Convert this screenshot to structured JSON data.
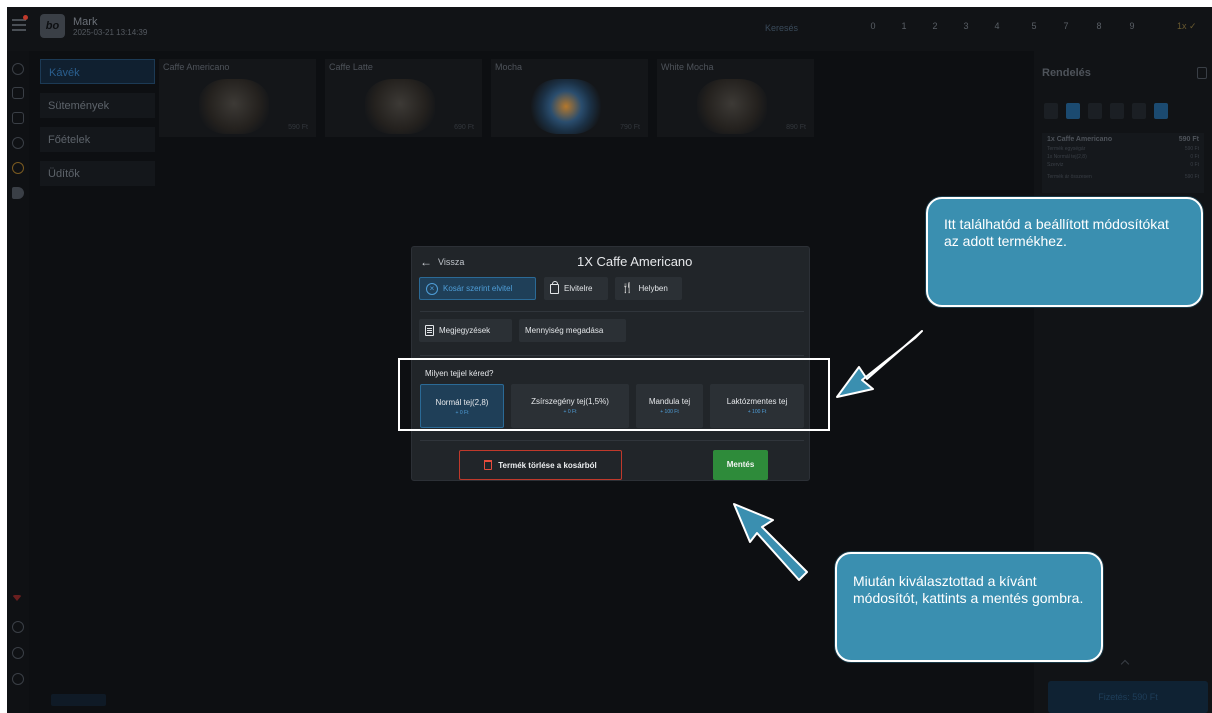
{
  "app": {
    "user_name": "Mark",
    "datetime": "2025-03-21 13:14:39",
    "search_placeholder": "Keresés",
    "numpad": [
      "0",
      "1",
      "2",
      "3",
      "4",
      "5",
      "7",
      "8",
      "9"
    ],
    "lang": "1x ✓"
  },
  "categories": [
    {
      "label": "Kávék",
      "active": true
    },
    {
      "label": "Sütemények",
      "active": false
    },
    {
      "label": "Főételek",
      "active": false
    },
    {
      "label": "Üdítők",
      "active": false
    }
  ],
  "products": [
    {
      "name": "Caffe Americano",
      "price": "590 Ft"
    },
    {
      "name": "Caffe Latte",
      "price": "690 Ft"
    },
    {
      "name": "Mocha",
      "price": "790 Ft"
    },
    {
      "name": "White Mocha",
      "price": "890 Ft"
    }
  ],
  "order": {
    "title": "Rendelés",
    "item_title": "1x Caffe Americano",
    "item_price": "590 Ft",
    "lines": [
      {
        "label": "Termék egységár",
        "value": "590 Ft"
      },
      {
        "label": "1x Normál tej(2,8)",
        "value": "0 Ft"
      },
      {
        "label": "Szerviz",
        "value": "0 Ft"
      },
      {
        "label": "Termék ár összesen",
        "value": "590 Ft"
      }
    ],
    "pay_label": "Fizetés: 590 Ft"
  },
  "modal": {
    "back_label": "Vissza",
    "title": "1X Caffe Americano",
    "takeaway_cart": "Kosár szerint elvitel",
    "takeaway": "Elvitelre",
    "dine_in": "Helyben",
    "notes": "Megjegyzések",
    "quantity": "Mennyiség megadása",
    "question": "Milyen tejjel kéred?",
    "milk_options": [
      {
        "name": "Normál tej(2,8)",
        "price": "+ 0 Ft",
        "selected": true
      },
      {
        "name": "Zsírszegény tej(1,5%)",
        "price": "+ 0 Ft",
        "selected": false
      },
      {
        "name": "Mandula tej",
        "price": "+ 100 Ft",
        "selected": false
      },
      {
        "name": "Laktózmentes tej",
        "price": "+ 100 Ft",
        "selected": false
      }
    ],
    "delete_label": "Termék törlése a kosárból",
    "save_label": "Mentés"
  },
  "callouts": {
    "top": "Itt találhatód a beállított módosítókat az adott termékhez.",
    "bottom": "Miután kiválasztottad a kívánt módosítót, kattints a mentés gombra."
  },
  "colors": {
    "accent_blue": "#4f9ed8",
    "save_green": "#2e8b3a",
    "delete_red": "#c0392b",
    "callout_bg": "#3a8fb0"
  }
}
